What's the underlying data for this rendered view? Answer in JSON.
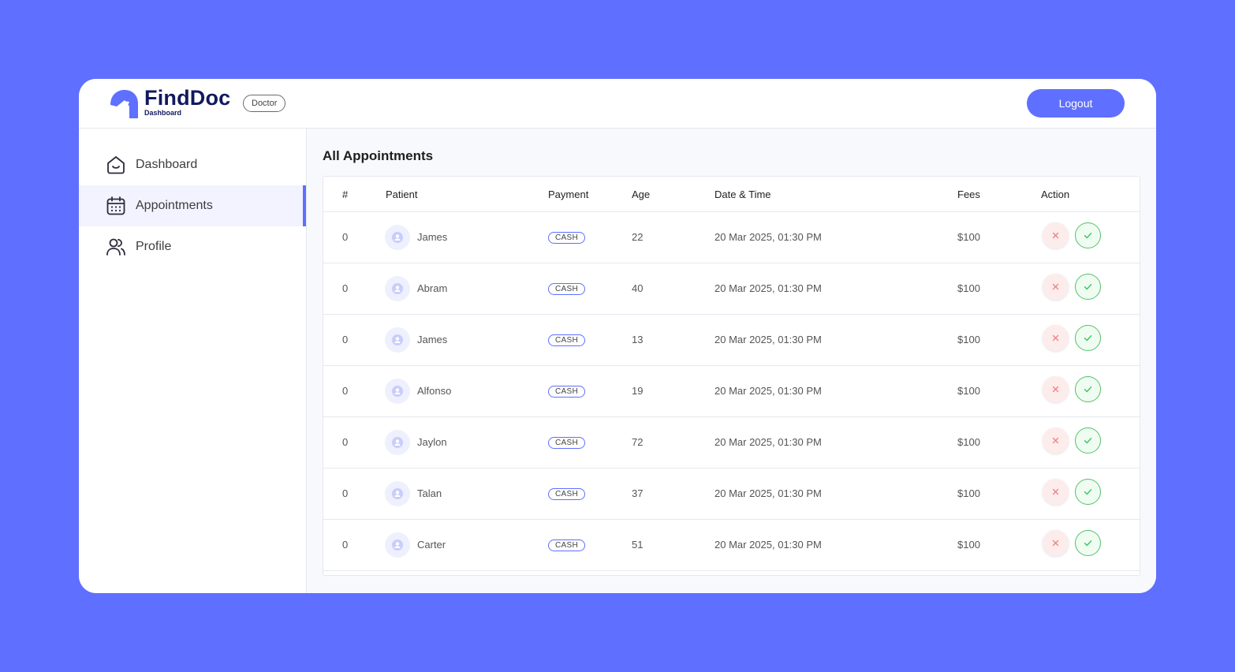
{
  "brand": {
    "title": "FindDoc",
    "subtitle": "Dashboard",
    "role_badge": "Doctor"
  },
  "header": {
    "logout_label": "Logout"
  },
  "colors": {
    "accent": "#5f6fff",
    "brand_dark": "#11195e",
    "cancel": "#f08080",
    "accept": "#34c759"
  },
  "sidebar": {
    "items": [
      {
        "label": "Dashboard",
        "icon": "home-icon",
        "active": false
      },
      {
        "label": "Appointments",
        "icon": "calendar-icon",
        "active": true
      },
      {
        "label": "Profile",
        "icon": "users-icon",
        "active": false
      }
    ]
  },
  "main": {
    "title": "All Appointments"
  },
  "table": {
    "headers": [
      "#",
      "Patient",
      "Payment",
      "Age",
      "Date & Time",
      "Fees",
      "Action"
    ],
    "rows": [
      {
        "index": "0",
        "patient": "James",
        "payment": "CASH",
        "age": "22",
        "datetime": "20 Mar 2025, 01:30 PM",
        "fees": "$100"
      },
      {
        "index": "0",
        "patient": "Abram",
        "payment": "CASH",
        "age": "40",
        "datetime": "20 Mar 2025, 01:30 PM",
        "fees": "$100"
      },
      {
        "index": "0",
        "patient": "James",
        "payment": "CASH",
        "age": "13",
        "datetime": "20 Mar 2025, 01:30 PM",
        "fees": "$100"
      },
      {
        "index": "0",
        "patient": "Alfonso",
        "payment": "CASH",
        "age": "19",
        "datetime": "20 Mar 2025, 01:30 PM",
        "fees": "$100"
      },
      {
        "index": "0",
        "patient": "Jaylon",
        "payment": "CASH",
        "age": "72",
        "datetime": "20 Mar 2025, 01:30 PM",
        "fees": "$100"
      },
      {
        "index": "0",
        "patient": "Talan",
        "payment": "CASH",
        "age": "37",
        "datetime": "20 Mar 2025, 01:30 PM",
        "fees": "$100"
      },
      {
        "index": "0",
        "patient": "Carter",
        "payment": "CASH",
        "age": "51",
        "datetime": "20 Mar 2025, 01:30 PM",
        "fees": "$100"
      }
    ]
  }
}
